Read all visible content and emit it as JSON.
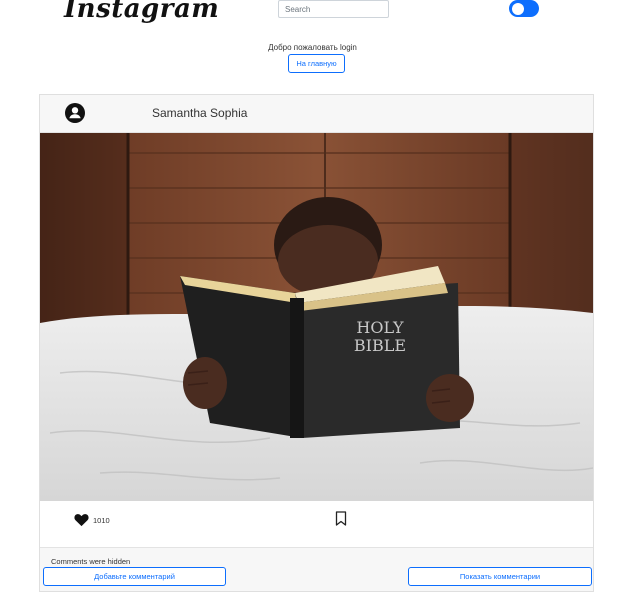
{
  "header": {
    "logo_text": "Instagram",
    "search_placeholder": "Search",
    "theme_toggle_on": true,
    "accent_color": "#0d6efd"
  },
  "welcome": {
    "text": "Добро пожаловать login",
    "home_button": "На главную"
  },
  "post": {
    "username": "Samantha Sophia",
    "avatar_icon": "user-circle-icon",
    "image_description": "child reading a Holy Bible book on a bed",
    "book_text": "HOLY BIBLE",
    "likes": "1010",
    "like_icon": "heart-icon",
    "save_icon": "bookmark-icon",
    "comments_status": "Comments were hidden",
    "add_comment_button": "Добавьте комментарий",
    "show_comments_button": "Показать комментарии"
  }
}
